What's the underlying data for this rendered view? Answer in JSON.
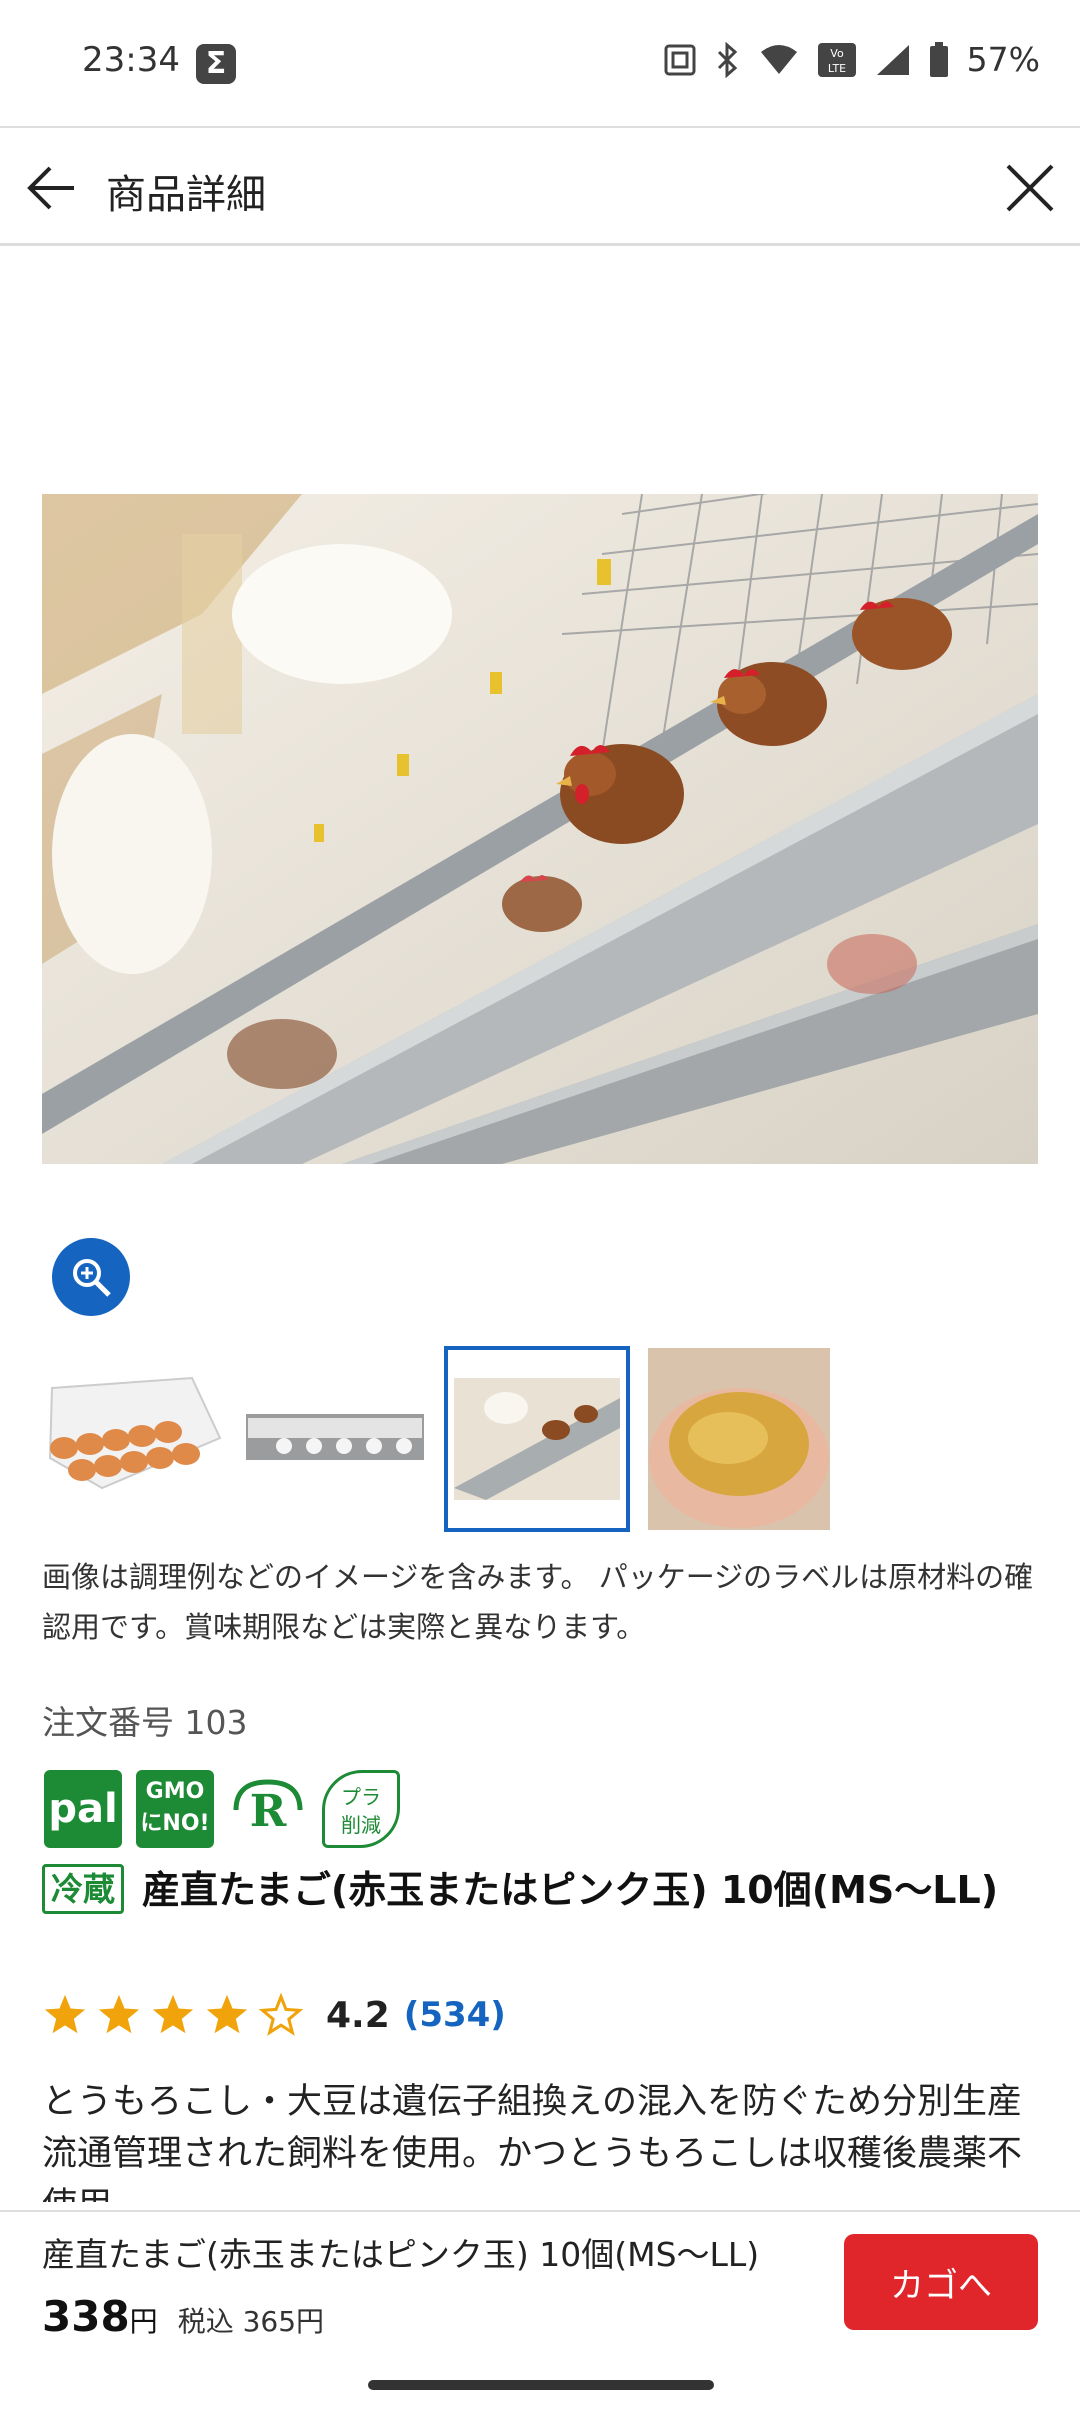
{
  "status_bar": {
    "time": "23:34",
    "battery": "57%",
    "icons": [
      "sigma-icon",
      "nfc-icon",
      "bluetooth-icon",
      "wifi-icon",
      "volte-icon",
      "signal-icon",
      "battery-icon"
    ]
  },
  "app_bar": {
    "title": "商品詳細"
  },
  "gallery": {
    "thumbnails": [
      "eggs-in-carton",
      "egg-carton-label",
      "chicken-farm",
      "feed-in-hands"
    ],
    "selected_index": 2
  },
  "image_note": "画像は調理例などのイメージを含みます。 パッケージのラベルは原材料の確認用です。賞味期限などは実際と異なります。",
  "order_number": "注文番号 103",
  "badges": {
    "pal": "pal",
    "gmo_line1": "GMO",
    "gmo_line2": "にNO!",
    "recycle": "R",
    "pla_line1": "プラ",
    "pla_line2": "削減"
  },
  "product": {
    "storage_tag": "冷蔵",
    "title": "産直たまご(赤玉またはピンク玉) 10個(MS〜LL)",
    "rating_value": "4.2",
    "rating_count": "(534)",
    "rating": 4.2,
    "description": "とうもろこし・大豆は遺伝子組換えの混入を防ぐため分別生産流通管理された飼料を使用。かつとうもろこしは収穫後農薬不使用"
  },
  "bottom_bar": {
    "name": "産直たまご(赤玉またはピンク玉) 10個(MS〜LL)",
    "price": "338",
    "yen": "円",
    "tax_included": "税込 365円",
    "cart_button": "カゴへ"
  },
  "colors": {
    "accent_blue": "#1565c0",
    "brand_green": "#1d8a35",
    "cart_red": "#e0262b",
    "star_gold": "#f0a30a"
  }
}
